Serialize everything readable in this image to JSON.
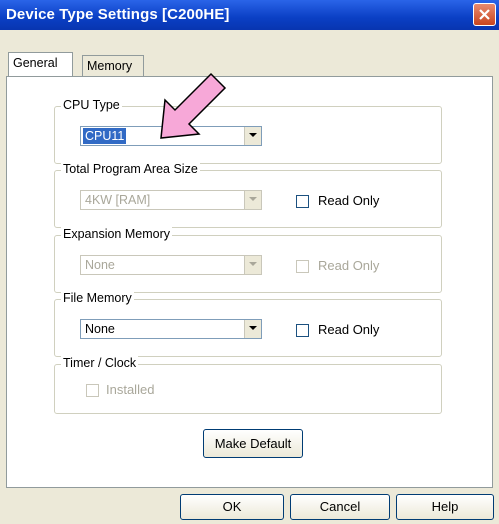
{
  "window": {
    "title": "Device Type Settings [C200HE]"
  },
  "tabs": [
    {
      "label": "General"
    },
    {
      "label": "Memory"
    }
  ],
  "cpu_type": {
    "label": "CPU Type",
    "value": "CPU11"
  },
  "program_area": {
    "label": "Total Program Area Size",
    "value": "4KW [RAM]",
    "read_only_label": "Read Only"
  },
  "expansion_memory": {
    "label": "Expansion Memory",
    "value": "None",
    "read_only_label": "Read Only"
  },
  "file_memory": {
    "label": "File Memory",
    "value": "None",
    "read_only_label": "Read Only"
  },
  "timer_clock": {
    "label": "Timer / Clock",
    "installed_label": "Installed"
  },
  "buttons": {
    "make_default": "Make Default",
    "ok": "OK",
    "cancel": "Cancel",
    "help": "Help"
  },
  "colors": {
    "annotation_arrow": "#f7a8d8",
    "titlebar": "#0a3fc4"
  }
}
